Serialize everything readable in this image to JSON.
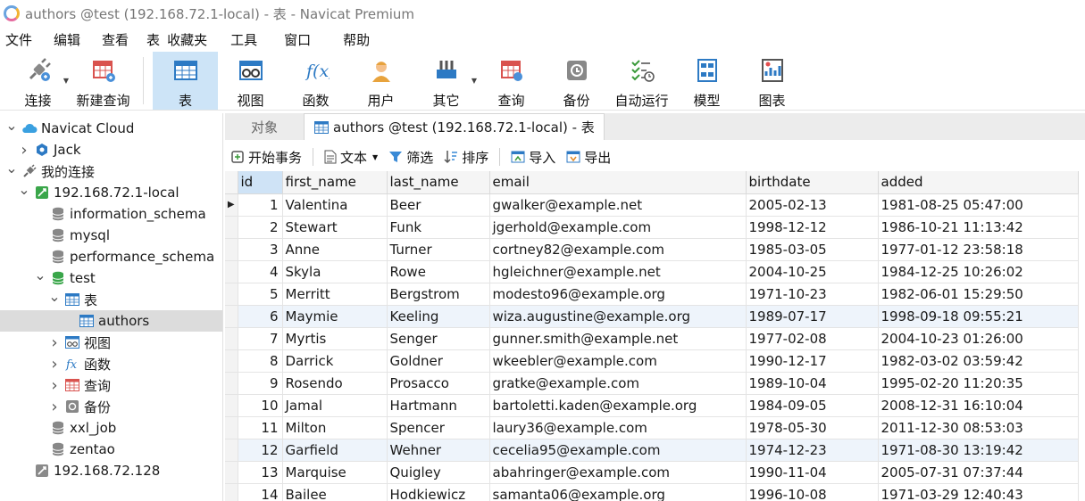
{
  "window": {
    "title": "authors @test (192.168.72.1-local) - 表 - Navicat Premium"
  },
  "menu": [
    "文件",
    "编辑",
    "查看",
    "表",
    "收藏夹",
    "工具",
    "窗口",
    "帮助"
  ],
  "toolbar": {
    "connect": "连接",
    "new_query": "新建查询",
    "table": "表",
    "view": "视图",
    "function": "函数",
    "user": "用户",
    "other": "其它",
    "query": "查询",
    "backup": "备份",
    "auto_run": "自动运行",
    "model": "模型",
    "chart": "图表"
  },
  "nav": {
    "items": [
      {
        "label": "Navicat Cloud",
        "level": 0,
        "chev": "v",
        "icon": "cloud-icon"
      },
      {
        "label": "Jack",
        "level": 1,
        "chev": ">",
        "icon": "hexagon-icon"
      },
      {
        "label": "我的连接",
        "level": 0,
        "chev": "v",
        "icon": "plug-icon"
      },
      {
        "label": "192.168.72.1-local",
        "level": 1,
        "chev": "v",
        "icon": "connection-icon"
      },
      {
        "label": "information_schema",
        "level": 2,
        "chev": "",
        "icon": "database-icon"
      },
      {
        "label": "mysql",
        "level": 2,
        "chev": "",
        "icon": "database-icon"
      },
      {
        "label": "performance_schema",
        "level": 2,
        "chev": "",
        "icon": "database-icon"
      },
      {
        "label": "test",
        "level": 2,
        "chev": "v",
        "icon": "database-open-icon"
      },
      {
        "label": "表",
        "level": 3,
        "chev": "v",
        "icon": "table-icon"
      },
      {
        "label": "authors",
        "level": 4,
        "chev": "",
        "icon": "table-icon",
        "selected": true
      },
      {
        "label": "视图",
        "level": 3,
        "chev": ">",
        "icon": "view-icon"
      },
      {
        "label": "函数",
        "level": 3,
        "chev": ">",
        "icon": "function-icon"
      },
      {
        "label": "查询",
        "level": 3,
        "chev": ">",
        "icon": "query-icon"
      },
      {
        "label": "备份",
        "level": 3,
        "chev": ">",
        "icon": "backup-icon"
      },
      {
        "label": "xxl_job",
        "level": 2,
        "chev": "",
        "icon": "database-icon"
      },
      {
        "label": "zentao",
        "level": 2,
        "chev": "",
        "icon": "database-icon"
      },
      {
        "label": "192.168.72.128",
        "level": 1,
        "chev": "",
        "icon": "connection-off-icon"
      }
    ]
  },
  "tabs": {
    "objects": "对象",
    "active": "authors @test (192.168.72.1-local) - 表"
  },
  "subtoolbar": {
    "begin_transaction": "开始事务",
    "text": "文本",
    "filter": "筛选",
    "sort": "排序",
    "import": "导入",
    "export": "导出"
  },
  "grid": {
    "columns": [
      "id",
      "first_name",
      "last_name",
      "email",
      "birthdate",
      "added"
    ],
    "rows": [
      [
        "1",
        "Valentina",
        "Beer",
        "gwalker@example.net",
        "2005-02-13",
        "1981-08-25 05:47:00"
      ],
      [
        "2",
        "Stewart",
        "Funk",
        "jgerhold@example.com",
        "1998-12-12",
        "1986-10-21 11:13:42"
      ],
      [
        "3",
        "Anne",
        "Turner",
        "cortney82@example.com",
        "1985-03-05",
        "1977-01-12 23:58:18"
      ],
      [
        "4",
        "Skyla",
        "Rowe",
        "hgleichner@example.net",
        "2004-10-25",
        "1984-12-25 10:26:02"
      ],
      [
        "5",
        "Merritt",
        "Bergstrom",
        "modesto96@example.org",
        "1971-10-23",
        "1982-06-01 15:29:50"
      ],
      [
        "6",
        "Maymie",
        "Keeling",
        "wiza.augustine@example.org",
        "1989-07-17",
        "1998-09-18 09:55:21"
      ],
      [
        "7",
        "Myrtis",
        "Senger",
        "gunner.smith@example.net",
        "1977-02-08",
        "2004-10-23 01:26:00"
      ],
      [
        "8",
        "Darrick",
        "Goldner",
        "wkeebler@example.com",
        "1990-12-17",
        "1982-03-02 03:59:42"
      ],
      [
        "9",
        "Rosendo",
        "Prosacco",
        "gratke@example.com",
        "1989-10-04",
        "1995-02-20 11:20:35"
      ],
      [
        "10",
        "Jamal",
        "Hartmann",
        "bartoletti.kaden@example.org",
        "1984-09-05",
        "2008-12-31 16:10:04"
      ],
      [
        "11",
        "Milton",
        "Spencer",
        "laury36@example.com",
        "1978-05-30",
        "2011-12-30 08:53:03"
      ],
      [
        "12",
        "Garfield",
        "Wehner",
        "cecelia95@example.com",
        "1974-12-23",
        "1971-08-30 13:19:42"
      ],
      [
        "13",
        "Marquise",
        "Quigley",
        "abahringer@example.com",
        "1990-11-04",
        "2005-07-31 07:37:44"
      ],
      [
        "14",
        "Bailee",
        "Hodkiewicz",
        "samanta06@example.org",
        "1996-10-08",
        "1971-03-29 12:40:43"
      ]
    ],
    "current_row": 0,
    "highlighted_rows": [
      5,
      11
    ]
  }
}
